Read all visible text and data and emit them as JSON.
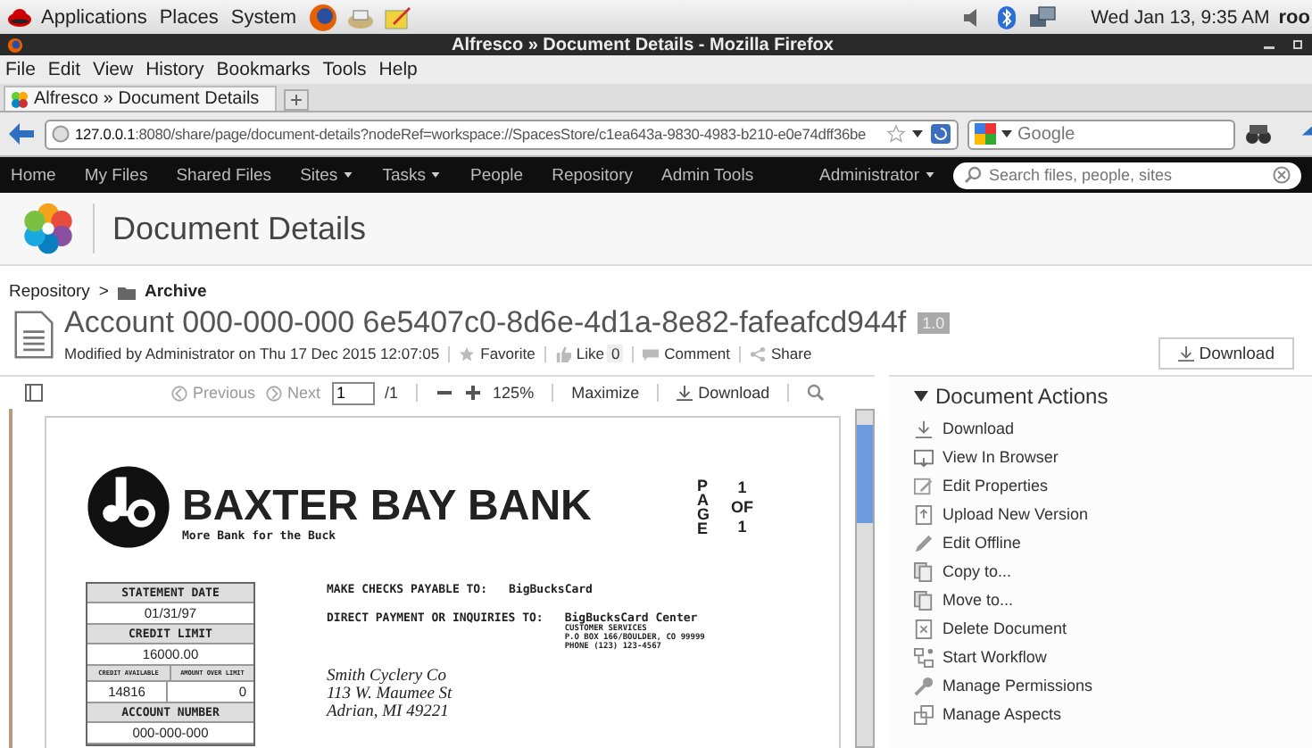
{
  "desktop_bar": {
    "menus": [
      "Applications",
      "Places",
      "System"
    ],
    "clock": "Wed Jan 13,  9:35 AM",
    "user": "roo"
  },
  "window": {
    "title": "Alfresco » Document Details - Mozilla Firefox"
  },
  "menu_bar": [
    "File",
    "Edit",
    "View",
    "History",
    "Bookmarks",
    "Tools",
    "Help"
  ],
  "tabs": [
    {
      "label": "Alfresco » Document Details",
      "selected": true
    }
  ],
  "address_bar": {
    "host": "127.0.0.1",
    "path": ":8080/share/page/document-details?nodeRef=workspace://SpacesStore/c1ea643a-9830-4983-b210-e0e74dff36be"
  },
  "search_engine": {
    "placeholder": "Google"
  },
  "app_nav": {
    "items": [
      {
        "label": "Home",
        "dropdown": false
      },
      {
        "label": "My Files",
        "dropdown": false
      },
      {
        "label": "Shared Files",
        "dropdown": false
      },
      {
        "label": "Sites",
        "dropdown": true
      },
      {
        "label": "Tasks",
        "dropdown": true
      },
      {
        "label": "People",
        "dropdown": false
      },
      {
        "label": "Repository",
        "dropdown": false
      },
      {
        "label": "Admin Tools",
        "dropdown": false
      }
    ],
    "user": {
      "label": "Administrator",
      "dropdown": true
    },
    "search": {
      "placeholder": "Search files, people, sites"
    }
  },
  "page_title": "Document Details",
  "breadcrumb": {
    "root": "Repository",
    "separator": ">",
    "folder": "Archive"
  },
  "document": {
    "title": "Account 000-000-000 6e5407c0-8d6e-4d1a-8e82-fafeafcd944f",
    "version": "1.0",
    "modified": "Modified by Administrator on Thu 17 Dec 2015 12:07:05",
    "favorite": "Favorite",
    "like": "Like",
    "like_count": "0",
    "comment": "Comment",
    "share": "Share"
  },
  "download_button": "Download",
  "viewer_toolbar": {
    "previous": "Previous",
    "next": "Next",
    "page": "1",
    "page_total": "/1",
    "zoom": "125%",
    "maximize": "Maximize",
    "download": "Download"
  },
  "preview": {
    "bank_name": "BAXTER BAY BANK",
    "slogan": "More Bank for the Buck",
    "page_label": "PAGE",
    "page_numbers": [
      "1",
      "OF",
      "1"
    ],
    "statement": {
      "date_label": "STATEMENT DATE",
      "date": "01/31/97",
      "limit_label": "CREDIT LIMIT",
      "limit": "16000.00",
      "available_label": "CREDIT AVAILABLE",
      "over_label": "AMOUNT OVER LIMIT",
      "available": "14816",
      "over": "0",
      "account_label": "ACCOUNT NUMBER",
      "account": "000-000-000"
    },
    "payable_label": "MAKE CHECKS PAYABLE TO:",
    "payable_to": "BigBucksCard",
    "inquiries_label": "DIRECT PAYMENT OR INQUIRIES TO:",
    "center_name": "BigBucksCard Center",
    "center_lines": [
      "CUSTOMER SERVICES",
      "P.O BOX 166/BOULDER, CO 99999",
      "PHONE (123) 123-4567"
    ],
    "address": [
      "Smith Cyclery Co",
      "113 W. Maumee St",
      "Adrian, MI 49221"
    ]
  },
  "document_actions": {
    "title": "Document Actions",
    "expanded": true,
    "items": [
      {
        "label": "Download",
        "kind": "download"
      },
      {
        "label": "View In Browser",
        "kind": "browser"
      },
      {
        "label": "Edit Properties",
        "kind": "edit"
      },
      {
        "label": "Upload New Version",
        "kind": "upload"
      },
      {
        "label": "Edit Offline",
        "kind": "pencil"
      },
      {
        "label": "Copy to...",
        "kind": "copy"
      },
      {
        "label": "Move to...",
        "kind": "copy"
      },
      {
        "label": "Delete Document",
        "kind": "delete"
      },
      {
        "label": "Start Workflow",
        "kind": "workflow"
      },
      {
        "label": "Manage Permissions",
        "kind": "key"
      },
      {
        "label": "Manage Aspects",
        "kind": "aspects"
      }
    ]
  }
}
